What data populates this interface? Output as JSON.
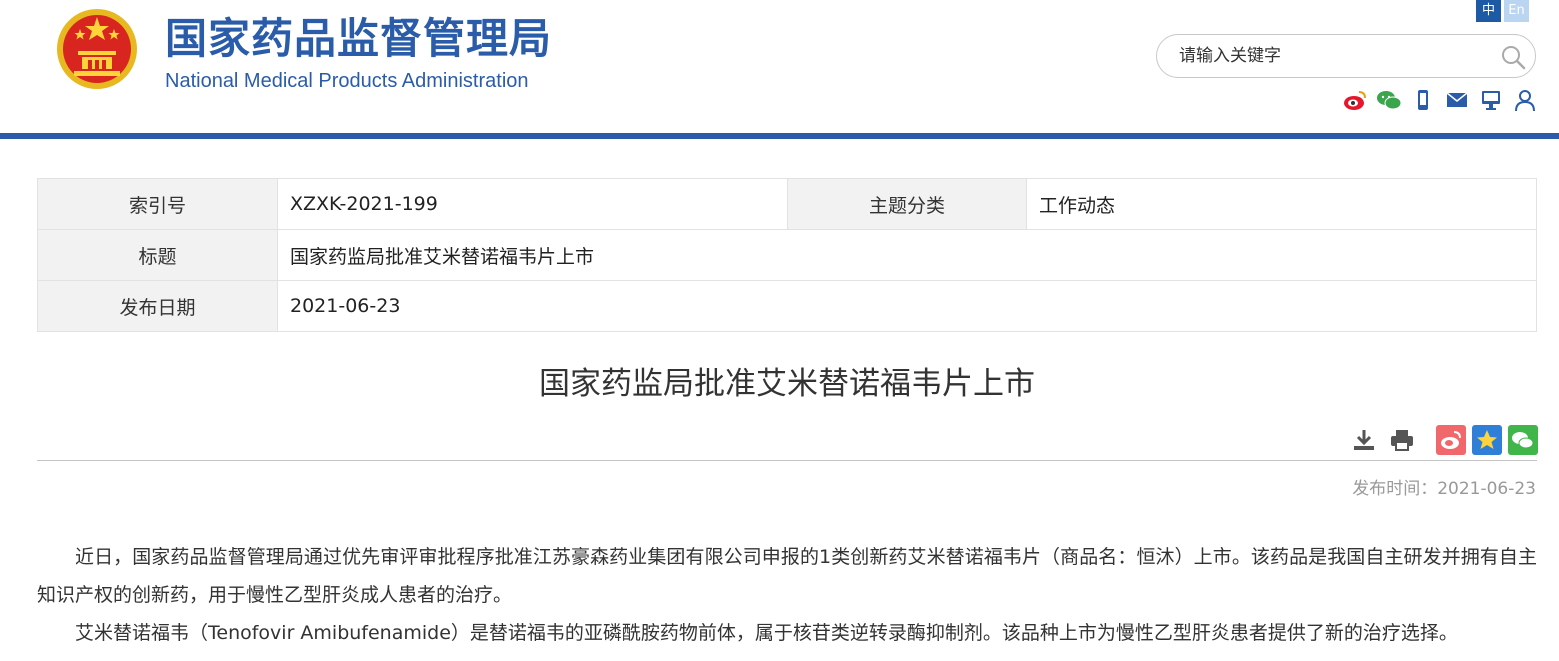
{
  "header": {
    "title_cn": "国家药品监督管理局",
    "title_en": "National Medical Products Administration",
    "lang_zh": "中",
    "lang_en": "En",
    "search_placeholder": "请输入关键字",
    "icons": [
      "weibo-icon",
      "wechat-icon",
      "mobile-icon",
      "mail-icon",
      "monitor-icon",
      "user-icon"
    ],
    "brand_color": "#2a5caa"
  },
  "info": {
    "index_label": "索引号",
    "index_value": "XZXK-2021-199",
    "category_label": "主题分类",
    "category_value": "工作动态",
    "title_label": "标题",
    "title_value": "国家药监局批准艾米替诺福韦片上市",
    "date_label": "发布日期",
    "date_value": "2021-06-23"
  },
  "article": {
    "title": "国家药监局批准艾米替诺福韦片上市",
    "publish_label": "发布时间：",
    "publish_date": "2021-06-23",
    "paragraphs": [
      "近日，国家药品监督管理局通过优先审评审批程序批准江苏豪森药业集团有限公司申报的1类创新药艾米替诺福韦片（商品名：恒沐）上市。该药品是我国自主研发并拥有自主知识产权的创新药，用于慢性乙型肝炎成人患者的治疗。",
      "艾米替诺福韦（Tenofovir Amibufenamide）是替诺福韦的亚磷酰胺药物前体，属于核苷类逆转录酶抑制剂。该品种上市为慢性乙型肝炎患者提供了新的治疗选择。"
    ]
  },
  "tools": [
    "download-icon",
    "print-icon",
    "share-weibo-icon",
    "favorite-icon",
    "share-wechat-icon"
  ]
}
